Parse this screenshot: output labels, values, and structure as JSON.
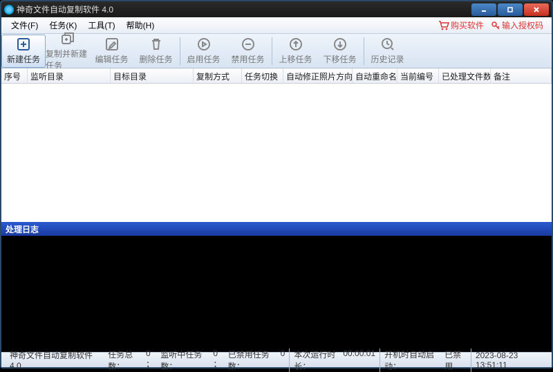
{
  "title": "神奇文件自动复制软件 4.0",
  "menu": {
    "file": "文件(F)",
    "task": "任务(K)",
    "tool": "工具(T)",
    "help": "帮助(H)",
    "buy": "购买软件",
    "auth": "输入授权码"
  },
  "toolbar": [
    {
      "label": "新建任务"
    },
    {
      "label": "复制并新建任务"
    },
    {
      "label": "编辑任务"
    },
    {
      "label": "删除任务"
    },
    {
      "label": "启用任务"
    },
    {
      "label": "禁用任务"
    },
    {
      "label": "上移任务"
    },
    {
      "label": "下移任务"
    },
    {
      "label": "历史记录"
    }
  ],
  "columns": [
    "序号",
    "监听目录",
    "目标目录",
    "复制方式",
    "任务切换",
    "自动修正照片方向",
    "自动重命名",
    "当前编号",
    "已处理文件数",
    "备注"
  ],
  "log_header": "处理日志",
  "status": {
    "app": "神奇文件自动复制软件 4.0",
    "total_label": "任务总数：",
    "total": "0 ；",
    "listen_label": "监听中任务数：",
    "listen": "0 ；",
    "disabled_label": "已禁用任务数：",
    "disabled": "0",
    "runtime_label": "本次运行时长：",
    "runtime": "00:00:01",
    "autostart_label": "开机时自动启动：",
    "autostart": "已禁用",
    "datetime": "2023-08-23 13:51:11"
  }
}
